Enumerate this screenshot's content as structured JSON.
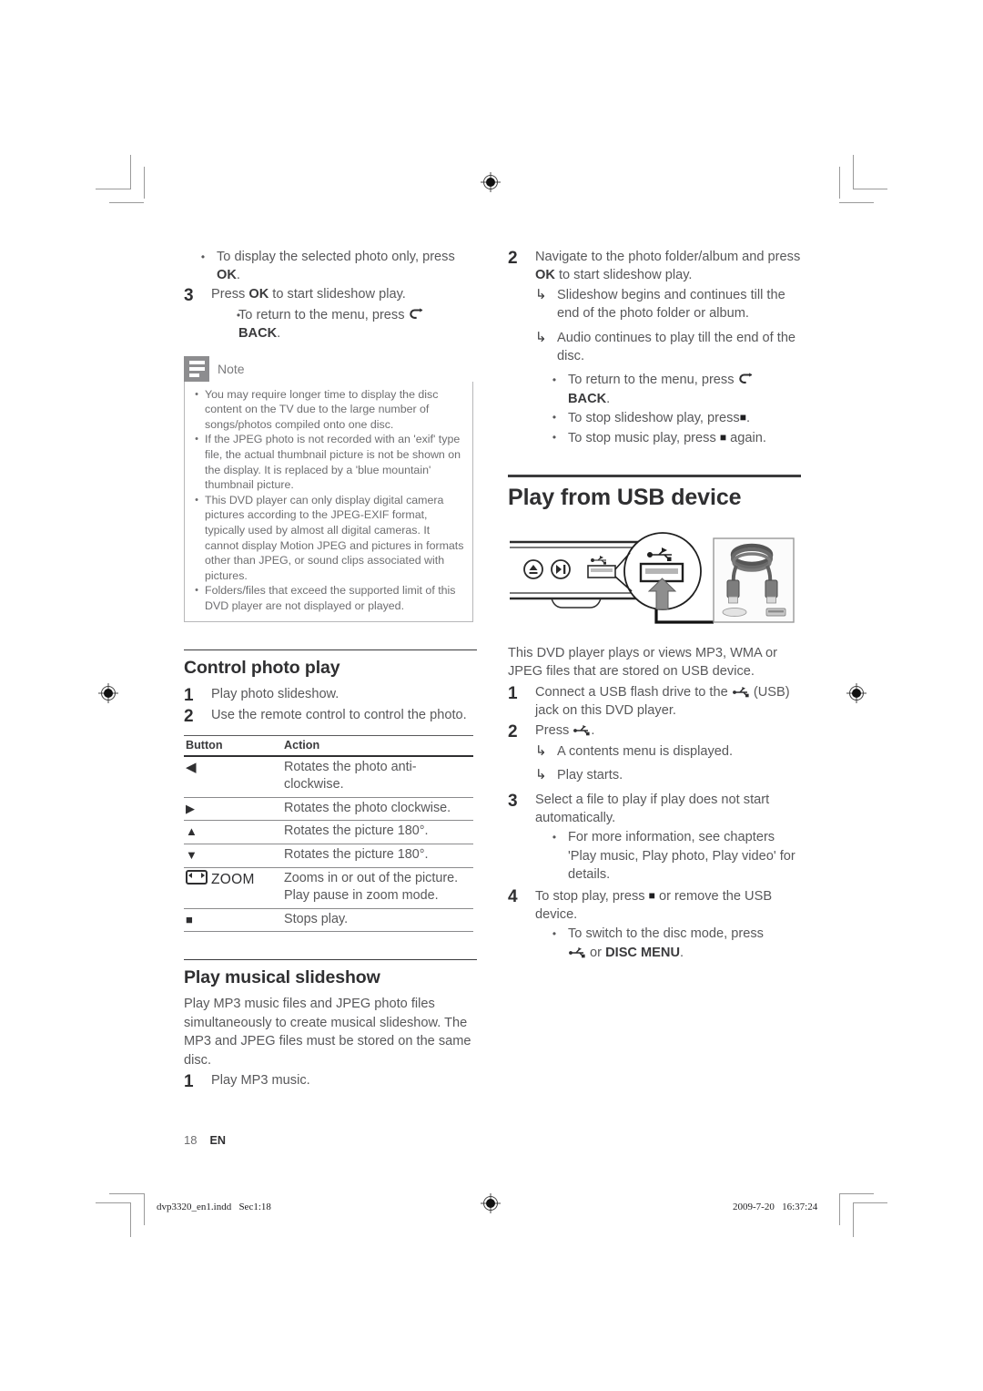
{
  "document": {
    "page_number": "18",
    "language_code": "EN",
    "print_footer_left": "dvp3320_en1.indd   Sec1:18",
    "print_footer_right": "2009-7-20   16:37:24"
  },
  "left_column": {
    "top_bullet": {
      "marker": "•",
      "text_before": "To display the selected photo only, press ",
      "bold": "OK",
      "text_after": "."
    },
    "step3": {
      "num": "3",
      "text_before": "Press ",
      "bold": "OK",
      "text_after": " to start slideshow play."
    },
    "step3_bullet": {
      "marker": "•",
      "text_before": "To return to the menu, press ",
      "icon": "back-arrow-icon",
      "bold": "BACK",
      "text_after": "."
    },
    "note": {
      "icon": "note-lines-icon",
      "title": "Note",
      "items": [
        "You may require longer time to display the disc content on the TV due to the large number of songs/photos compiled onto one disc.",
        "If the JPEG photo is not recorded with an 'exif' type file, the actual thumbnail picture is not be shown on the display. It is replaced by a 'blue mountain' thumbnail picture.",
        "This DVD player can only display digital camera pictures according to the JPEG-EXIF format, typically used by almost all digital cameras. It cannot display Motion JPEG and pictures in formats other than JPEG, or sound clips associated with pictures.",
        "Folders/files that exceed the supported limit of this DVD player are not displayed or played."
      ]
    },
    "control_photo_play": {
      "title": "Control photo play",
      "steps": [
        {
          "num": "1",
          "text": "Play photo slideshow."
        },
        {
          "num": "2",
          "text": "Use the remote control to control the photo."
        }
      ],
      "table": {
        "headers": [
          "Button",
          "Action"
        ],
        "rows": [
          {
            "button_icon": "left-arrow-icon",
            "button_glyph": "◀",
            "button_label": "",
            "action": "Rotates the photo anti-clockwise."
          },
          {
            "button_icon": "right-arrow-icon",
            "button_glyph": "▶",
            "button_label": "",
            "action": "Rotates the photo clockwise."
          },
          {
            "button_icon": "up-arrow-icon",
            "button_glyph": "▲",
            "button_label": "",
            "action": "Rotates the picture 180°."
          },
          {
            "button_icon": "down-arrow-icon",
            "button_glyph": "▼",
            "button_label": "",
            "action": "Rotates the picture 180°."
          },
          {
            "button_icon": "zoom-icon",
            "button_glyph": "",
            "button_label": "ZOOM",
            "action": "Zooms in or out of the picture.\nPlay pause in zoom mode."
          },
          {
            "button_icon": "stop-square-icon",
            "button_glyph": "■",
            "button_label": "",
            "action": "Stops play."
          }
        ]
      }
    },
    "play_musical_slideshow": {
      "title": "Play musical slideshow",
      "intro": "Play MP3 music files and JPEG photo files simultaneously to create musical slideshow. The MP3 and JPEG files must be stored on the same disc.",
      "step1": {
        "num": "1",
        "text": "Play MP3 music."
      }
    }
  },
  "right_column": {
    "step2": {
      "num": "2",
      "text_before": "Navigate to the photo folder/album and press ",
      "bold": "OK",
      "text_after": " to start slideshow play."
    },
    "results": [
      "Slideshow begins and continues till the end of the photo folder or album.",
      "Audio continues to play till the end of the disc."
    ],
    "bullets": [
      {
        "text_before": "To return to the menu, press ",
        "icon": "back-arrow-icon",
        "bold": "BACK",
        "text_after": "."
      },
      {
        "text_before": "To stop slideshow play, press",
        "icon": "stop-square-icon",
        "bold": "",
        "text_after": "."
      },
      {
        "text_before": "To stop music play, press ",
        "icon": "stop-square-icon",
        "bold": "",
        "text_after": " again."
      }
    ],
    "usb_section": {
      "title": "Play from USB device",
      "illustration": {
        "name": "dvd-player-usb-jack-illustration",
        "player_buttons": [
          "eject-icon",
          "play-pause-icon"
        ],
        "usb_symbol": "usb-trident-icon",
        "callout": "usb-jack-closeup",
        "photo_label": "usb-cable-photo"
      },
      "intro": "This DVD player plays or views MP3, WMA or JPEG files that are stored on USB device.",
      "steps": [
        {
          "num": "1",
          "text_before": "Connect a USB flash drive to the ",
          "icon": "usb-trident-icon",
          "text_after": " (USB) jack on this DVD player."
        },
        {
          "num": "2",
          "text_before": "Press ",
          "icon": "usb-trident-icon",
          "text_after": "."
        },
        {
          "num": "3",
          "text_before": "Select a file to play if play does not start automatically.",
          "icon": "",
          "text_after": ""
        },
        {
          "num": "4",
          "text_before": "To stop play, press ",
          "icon": "stop-square-icon",
          "text_after": " or remove the USB device."
        }
      ],
      "step2_results": [
        "A contents menu is displayed.",
        "Play starts."
      ],
      "step3_bullet": "For more information, see chapters 'Play music, Play photo, Play video' for details.",
      "step4_bullet": {
        "text_before": "To switch to the disc mode, press ",
        "icon": "usb-trident-icon",
        "middle": " or ",
        "bold": "DISC MENU",
        "text_after": "."
      }
    }
  },
  "colors": {
    "body_text": "#58585a",
    "heading": "#2f2f31",
    "note_icon_bg": "#8d8d8f",
    "rule": "#3b3b3d"
  }
}
